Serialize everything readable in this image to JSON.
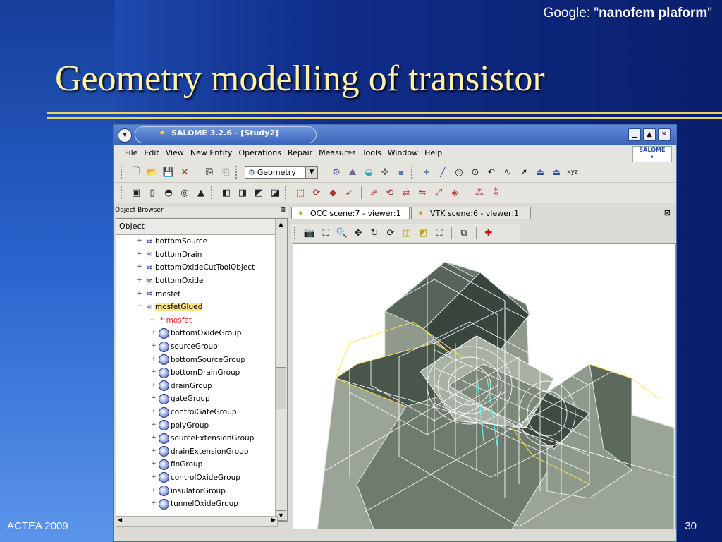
{
  "header": {
    "google_prefix": "Google: \"",
    "google_query": "nanofem plaform",
    "google_suffix": "\""
  },
  "slide": {
    "title": "Geometry modelling of transistor",
    "footer_left": "ACTEA 2009",
    "page_number": "30"
  },
  "window": {
    "title": "SALOME 3.2.6 - [Study2]",
    "logo_text": "SALOME",
    "menu": [
      "File",
      "Edit",
      "View",
      "New Entity",
      "Operations",
      "Repair",
      "Measures",
      "Tools",
      "Window",
      "Help"
    ],
    "module_combo": "Geometry"
  },
  "object_browser": {
    "title": "Object Browser",
    "column_header": "Object",
    "items": [
      {
        "label": "bottomSource",
        "level": 1
      },
      {
        "label": "bottomDrain",
        "level": 1
      },
      {
        "label": "bottomOxideCutToolObject",
        "level": 1
      },
      {
        "label": "bottomOxide",
        "level": 1
      },
      {
        "label": "mosfet",
        "level": 1
      },
      {
        "label": "mosfetGlued",
        "level": 1,
        "selected": true
      },
      {
        "label": "* mosfet",
        "level": 2,
        "reference": true
      },
      {
        "label": "bottomOxideGroup",
        "level": 2
      },
      {
        "label": "sourceGroup",
        "level": 2
      },
      {
        "label": "bottomSourceGroup",
        "level": 2
      },
      {
        "label": "bottomDrainGroup",
        "level": 2
      },
      {
        "label": "drainGroup",
        "level": 2
      },
      {
        "label": "gateGroup",
        "level": 2
      },
      {
        "label": "controlGateGroup",
        "level": 2
      },
      {
        "label": "polyGroup",
        "level": 2
      },
      {
        "label": "sourceExtensionGroup",
        "level": 2
      },
      {
        "label": "drainExtensionGroup",
        "level": 2
      },
      {
        "label": "finGroup",
        "level": 2
      },
      {
        "label": "controlOxideGroup",
        "level": 2
      },
      {
        "label": "insulatorGroup",
        "level": 2
      },
      {
        "label": "tunnelOxideGroup",
        "level": 2
      }
    ]
  },
  "viewer": {
    "tabs": [
      "OCC scene:7 - viewer:1",
      "VTK scene:6 - viewer:1"
    ],
    "active_tab": 0
  }
}
